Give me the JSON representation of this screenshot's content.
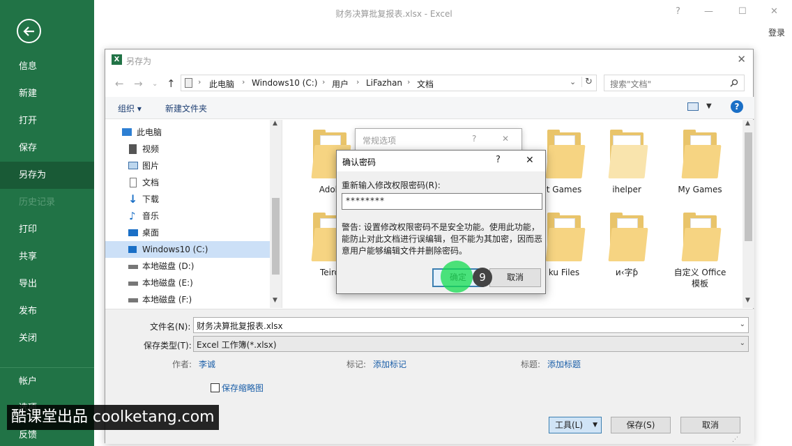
{
  "app": {
    "title": "财务决算批复报表.xlsx - Excel",
    "help": "?",
    "minimize": "—",
    "maximize": "☐",
    "close": "✕",
    "login": "登录"
  },
  "sidebar": {
    "items": [
      "信息",
      "新建",
      "打开",
      "保存",
      "另存为",
      "历史记录",
      "打印",
      "共享",
      "导出",
      "发布",
      "关闭",
      "帐户",
      "选项",
      "反馈"
    ]
  },
  "saveas": {
    "title": "另存为",
    "close": "✕",
    "breadcrumb": [
      "此电脑",
      "Windows10 (C:)",
      "用户",
      "LiFazhan",
      "文档"
    ],
    "search_placeholder": "搜索\"文档\"",
    "organize": "组织 ▾",
    "new_folder": "新建文件夹",
    "help": "?",
    "tree": [
      "此电脑",
      "视频",
      "图片",
      "文档",
      "下载",
      "音乐",
      "桌面",
      "Windows10 (C:)",
      "本地磁盘 (D:)",
      "本地磁盘 (E:)",
      "本地磁盘 (F:)"
    ],
    "files": [
      "Adob",
      "t Games",
      "ihelper",
      "My Games",
      "Teiro",
      "ku Files",
      "и‹字ƥ",
      "自定义 Office 模板"
    ],
    "filename_label": "文件名(N):",
    "filename": "财务决算批复报表.xlsx",
    "filetype_label": "保存类型(T):",
    "filetype": "Excel 工作簿(*.xlsx)",
    "author_label": "作者:",
    "author": "李诚",
    "tags_label": "标记:",
    "tags": "添加标记",
    "title_label": "标题:",
    "title_value": "添加标题",
    "thumbnail": "保存缩略图",
    "tools": "工具(L)",
    "save": "保存(S)",
    "cancel": "取消"
  },
  "general_options": {
    "title": "常规选项",
    "help": "?",
    "close": "✕"
  },
  "confirm": {
    "title": "确认密码",
    "help": "?",
    "close": "✕",
    "label": "重新输入修改权限密码(R):",
    "value": "********",
    "warning": "警告: 设置修改权限密码不是安全功能。使用此功能，能防止对此文档进行误编辑，但不能为其加密，因而恶意用户能够编辑文件并删除密码。",
    "ok": "确定",
    "cancel": "取消"
  },
  "overlay": {
    "step": "9",
    "watermark": "酷课堂出品 coolketang.com"
  }
}
